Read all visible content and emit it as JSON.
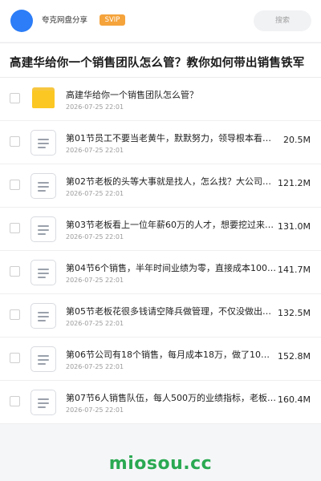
{
  "header": {
    "username": "夸克网盘分享",
    "badge": "SVIP",
    "search_placeholder": "搜索"
  },
  "page_title": "高建华给你一个销售团队怎么管？教你如何带出销售铁军",
  "files": [
    {
      "type": "folder",
      "name": "高建华给你一个销售团队怎么管？",
      "date": "2026-07-25 22:01",
      "size": ""
    },
    {
      "type": "doc",
      "name": "第01节员工不要当老黄牛，默默努力，领导根本看不到…",
      "date": "2026-07-25 22:01",
      "size": "20.5M"
    },
    {
      "type": "doc",
      "name": "第02节老板的头等大事就是找人，怎么找？大公司找猎…",
      "date": "2026-07-25 22:01",
      "size": "121.2M"
    },
    {
      "type": "doc",
      "name": "第03节老板看上一位年薪60万的人才，想要挖过来，…",
      "date": "2026-07-25 22:01",
      "size": "131.0M"
    },
    {
      "type": "doc",
      "name": "第04节6个销售，半年时间业绩为零，直接成本100…",
      "date": "2026-07-25 22:01",
      "size": "141.7M"
    },
    {
      "type": "doc",
      "name": "第05节老板花很多钱请空降兵做管理，不仅没做出成绩…",
      "date": "2026-07-25 22:01",
      "size": "132.5M"
    },
    {
      "type": "doc",
      "name": "第06节公司有18个销售，每月成本18万，做了10…",
      "date": "2026-07-25 22:01",
      "size": "152.8M"
    },
    {
      "type": "doc",
      "name": "第07节6人销售队伍，每人500万的业绩指标，老板…",
      "date": "2026-07-25 22:01",
      "size": "160.4M"
    }
  ],
  "watermark": "miosou.cc",
  "colors": {
    "avatar": "#2c7df7",
    "badge": "#f5a33b",
    "folder": "#fbc723",
    "watermark": "#2aa952"
  }
}
